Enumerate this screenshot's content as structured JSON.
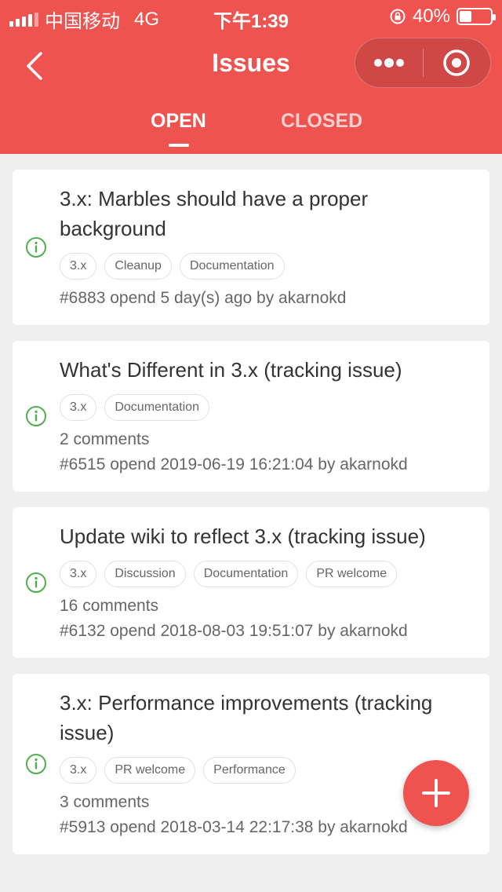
{
  "status_bar": {
    "carrier": "中国移动",
    "network": "4G",
    "time": "下午1:39",
    "battery_percent": "40%",
    "battery_level": 0.4
  },
  "nav": {
    "title": "Issues",
    "back_icon": "chevron-left-icon",
    "more_icon": "more-dots-icon",
    "close_icon": "target-circle-icon"
  },
  "tabs": [
    {
      "label": "OPEN",
      "active": true
    },
    {
      "label": "CLOSED",
      "active": false
    }
  ],
  "colors": {
    "accent": "#ef5350",
    "open_status": "#4caf50",
    "background": "#efefef"
  },
  "issues": [
    {
      "title": "3.x: Marbles should have a proper background",
      "tags": [
        "3.x",
        "Cleanup",
        "Documentation"
      ],
      "comments": "",
      "meta": "#6883 opend 5 day(s) ago by akarnokd"
    },
    {
      "title": "What's Different in 3.x (tracking issue)",
      "tags": [
        "3.x",
        "Documentation"
      ],
      "comments": "2 comments",
      "meta": "#6515 opend 2019-06-19 16:21:04 by akarnokd"
    },
    {
      "title": "Update wiki to reflect 3.x (tracking issue)",
      "tags": [
        "3.x",
        "Discussion",
        "Documentation",
        "PR welcome"
      ],
      "comments": "16 comments",
      "meta": "#6132 opend 2018-08-03 19:51:07 by akarnokd"
    },
    {
      "title": "3.x: Performance improvements (tracking issue)",
      "tags": [
        "3.x",
        "PR welcome",
        "Performance"
      ],
      "comments": "3 comments",
      "meta": "#5913 opend 2018-03-14 22:17:38 by akarnokd"
    }
  ],
  "fab": {
    "icon": "plus-icon"
  }
}
